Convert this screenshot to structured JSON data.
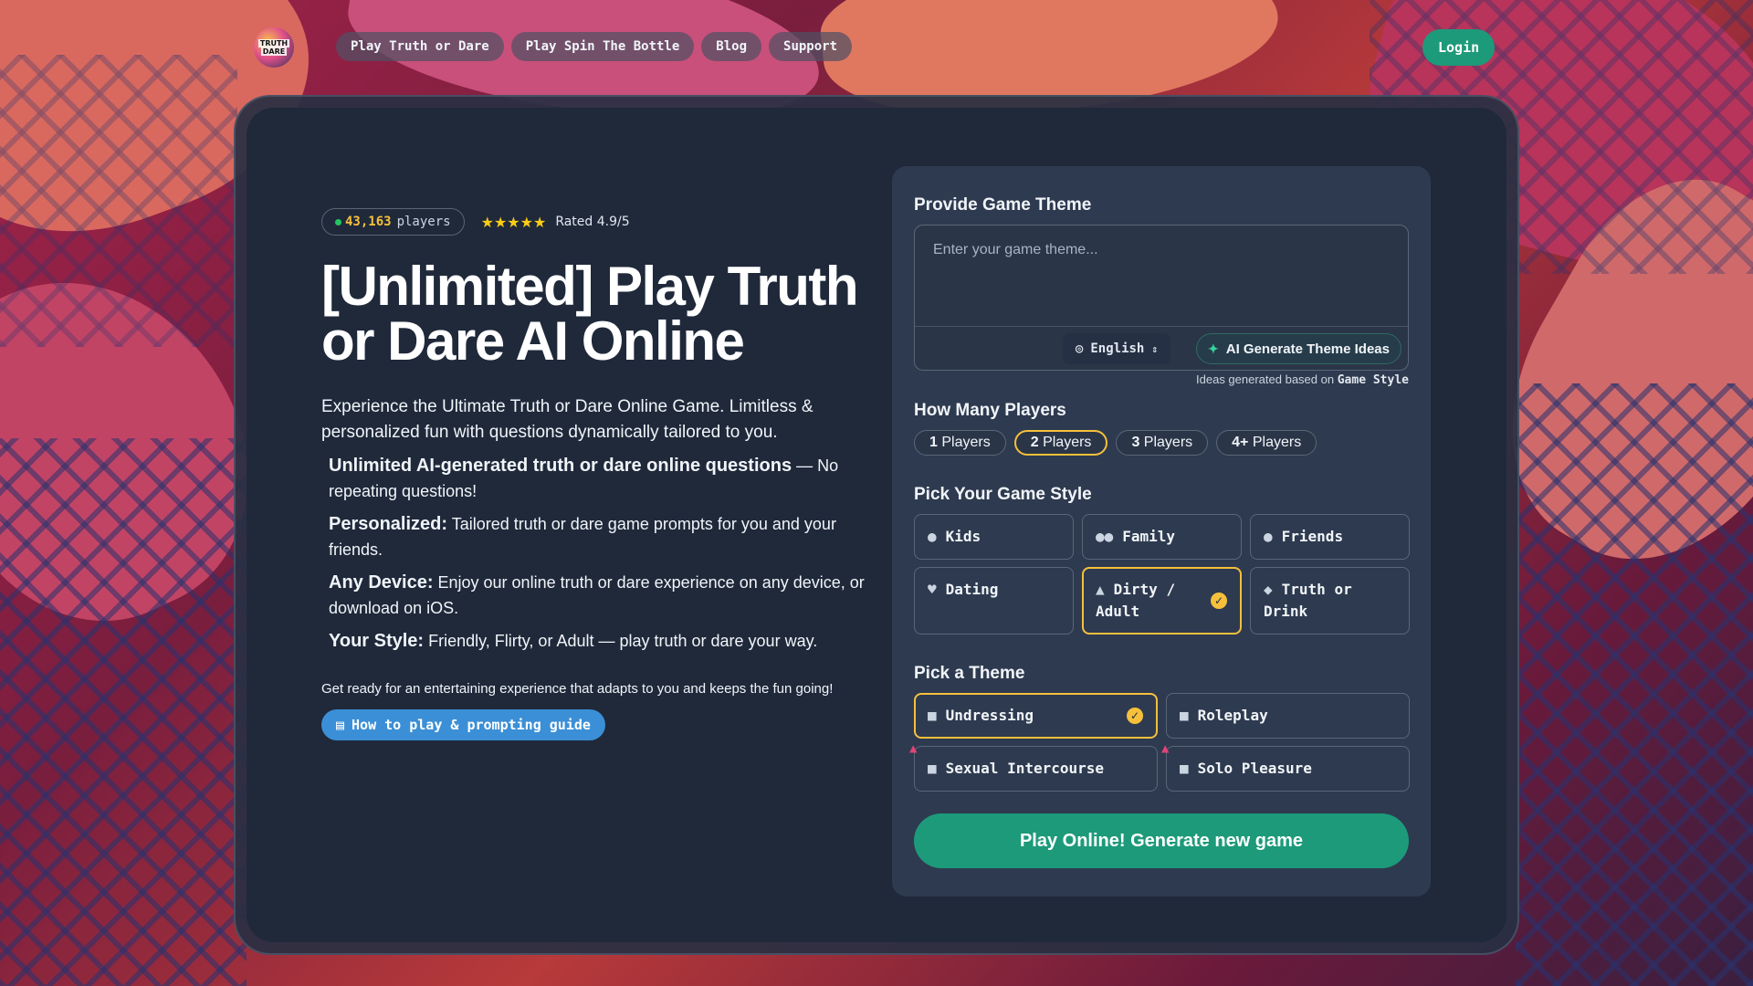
{
  "header": {
    "logo_line1": "TRUTH",
    "logo_line2": "DARE",
    "nav": [
      "Play Truth or Dare",
      "Play Spin The Bottle",
      "Blog",
      "Support"
    ],
    "login": "Login"
  },
  "hero": {
    "players_count": "43,163",
    "players_suffix": "players",
    "stars": "★★★★★",
    "rated": "Rated 4.9/5",
    "title": "[Unlimited] Play Truth or Dare AI Online",
    "subtitle": "Experience the Ultimate Truth or Dare Online Game. Limitless & personalized fun with questions dynamically tailored to you.",
    "features": [
      {
        "bold": "Unlimited AI-generated truth or dare online questions",
        "text": " — No repeating questions!"
      },
      {
        "bold": "Personalized:",
        "text": " Tailored truth or dare game prompts for you and your friends."
      },
      {
        "bold": "Any Device:",
        "text": " Enjoy our online truth or dare experience on any device, or download on iOS."
      },
      {
        "bold": "Your Style:",
        "text": " Friendly, Flirty, or  Adult — play truth or dare your way."
      }
    ],
    "ready": "Get ready for an entertaining experience that adapts to you and keeps the fun going!",
    "guide": "How to play & prompting guide"
  },
  "panel": {
    "theme_title": "Provide Game Theme",
    "theme_placeholder": "Enter your game theme...",
    "language": "English",
    "ai_button": "AI Generate Theme Ideas",
    "ideas_prefix": "Ideas generated based on",
    "ideas_bold": "Game Style",
    "players_title": "How Many Players",
    "players": [
      {
        "num": "1",
        "label": "Players",
        "active": false
      },
      {
        "num": "2",
        "label": "Players",
        "active": true
      },
      {
        "num": "3",
        "label": "Players",
        "active": false
      },
      {
        "num": "4+",
        "label": "Players",
        "active": false
      }
    ],
    "style_title": "Pick Your Game Style",
    "styles": [
      {
        "label": "Kids",
        "icon": "child-icon",
        "active": false
      },
      {
        "label": "Family",
        "icon": "family-icon",
        "active": false
      },
      {
        "label": "Friends",
        "icon": "friends-icon",
        "active": false
      },
      {
        "label": "Dating",
        "icon": "heart-icon",
        "active": false
      },
      {
        "label": "Dirty / Adult",
        "icon": "flame-icon",
        "active": true
      },
      {
        "label": "Truth or Drink",
        "icon": "drink-icon",
        "active": false
      }
    ],
    "theme_pick_title": "Pick a Theme",
    "themes": [
      {
        "label": "Undressing",
        "active": true
      },
      {
        "label": "Roleplay",
        "active": false
      },
      {
        "label": "Sexual Intercourse",
        "active": false
      },
      {
        "label": "Solo Pleasure",
        "active": false
      }
    ],
    "play": "Play Online! Generate new game"
  },
  "colors": {
    "accent": "#1d9a7a",
    "highlight": "#f6c03b",
    "guide": "#3b8fd6",
    "panel": "#2e3a4f",
    "card": "#1f293a"
  }
}
